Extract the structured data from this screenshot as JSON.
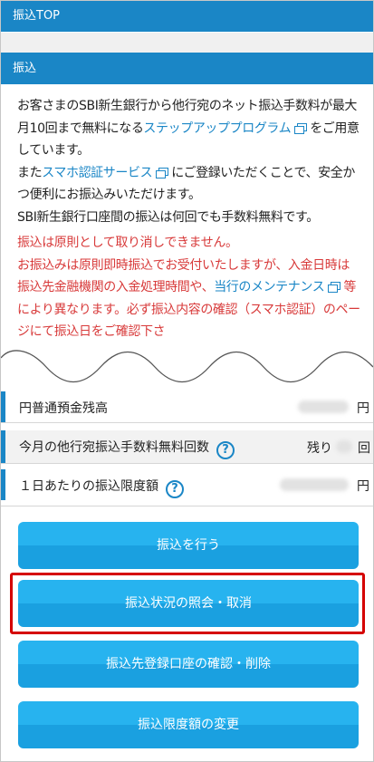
{
  "header": {
    "title": "振込TOP"
  },
  "section": {
    "title": "振込"
  },
  "description": {
    "p1_pre": "お客さまのSBI新生銀行から他行宛のネット振込手数料が最大月10回まで無料になる",
    "p1_link": "ステップアッププログラム",
    "p1_post": "をご用意しています。",
    "p2_pre": "また",
    "p2_link": "スマホ認証サービス",
    "p2_post": "にご登録いただくことで、安全かつ便利にお振込みいただけます。",
    "p3": "SBI新生銀行口座間の振込は何回でも手数料無料です。"
  },
  "notice": {
    "line1": "振込は原則として取り消しできません。",
    "line2_pre": "お振込みは原則即時振込でお受付いたしますが、入金日時は振込先金融機関の入金処理時間や、",
    "line2_link": "当行のメンテナンス",
    "line2_post": "等により異なります。必ず振込内容の確認（スマホ認証）のページにて振込日をご確認下さ"
  },
  "info": {
    "balance_label": "円普通預金残高",
    "balance_unit": "円",
    "free_count_label": "今月の他行宛振込手数料無料回数",
    "free_count_prefix": "残り",
    "free_count_unit": "回",
    "limit_label": "１日あたりの振込限度額",
    "limit_unit": "円",
    "help": "?"
  },
  "buttons": {
    "transfer": "振込を行う",
    "status": "振込状況の照会・取消",
    "registered": "振込先登録口座の確認・削除",
    "limit_change": "振込限度額の変更"
  },
  "colors": {
    "primary": "#1a86c6",
    "button": "#27b3ef",
    "notice": "#d83a3a",
    "highlight": "#d50000"
  }
}
